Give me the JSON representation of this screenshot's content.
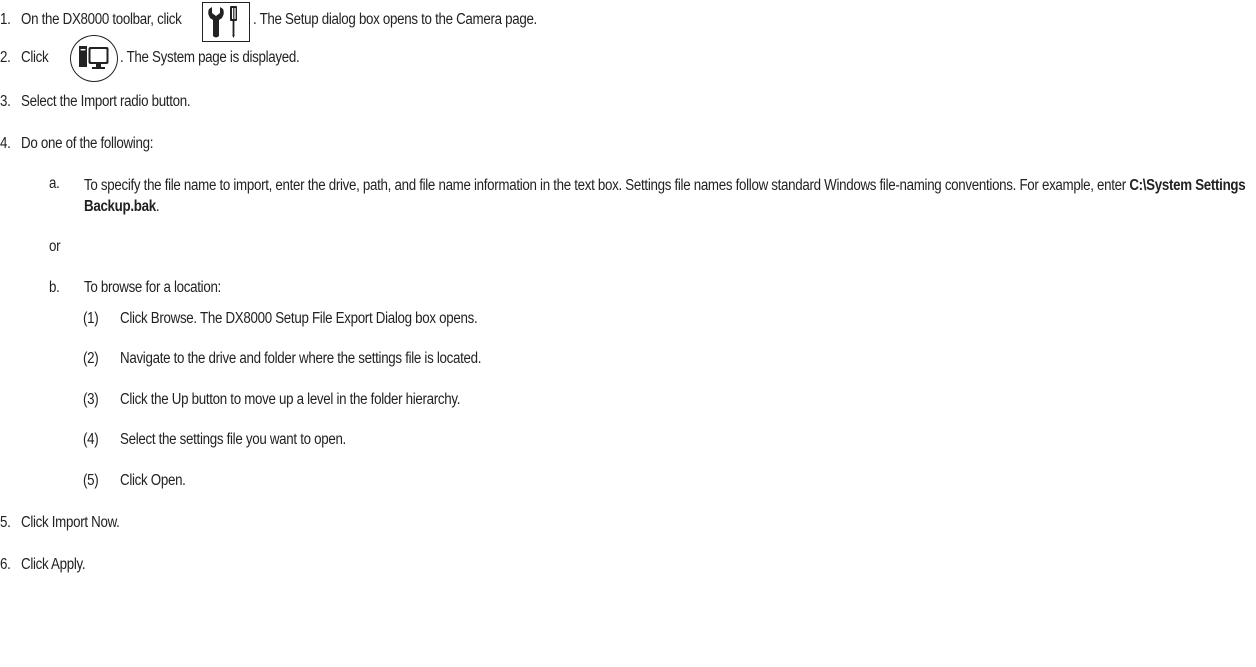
{
  "steps": [
    {
      "num": "1.",
      "pre": "On the DX8000 toolbar, click",
      "post": ". The Setup dialog box opens to the Camera page.",
      "icon": "setup-tools-icon"
    },
    {
      "num": "2.",
      "pre": "Click",
      "post": ". The System page is displayed.",
      "icon": "system-computer-icon"
    },
    {
      "num": "3.",
      "text": "Select the Import radio button."
    },
    {
      "num": "4.",
      "text": "Do one of the following:"
    },
    {
      "num": "5.",
      "text": "Click Import Now."
    },
    {
      "num": "6.",
      "text": "Click Apply."
    }
  ],
  "option_a": {
    "label": "a.",
    "text": "To specify the file name to import, enter the drive, path, and file name information in the text box. Settings file names follow standard Windows file-naming conventions. For example, enter ",
    "example": "C:\\System Settings Backup.bak",
    "end": "."
  },
  "or_text": "or",
  "option_b": {
    "label": "b.",
    "text": "To browse for a location:",
    "substeps": [
      {
        "num": "(1)",
        "text": "Click Browse. The DX8000 Setup File Export Dialog box opens."
      },
      {
        "num": "(2)",
        "text": "Navigate to the drive and folder where the settings file is located."
      },
      {
        "num": "(3)",
        "text": "Click the Up button to move up a level in the folder hierarchy."
      },
      {
        "num": "(4)",
        "text": "Select the settings file you want to open."
      },
      {
        "num": "(5)",
        "text": "Click Open."
      }
    ]
  }
}
